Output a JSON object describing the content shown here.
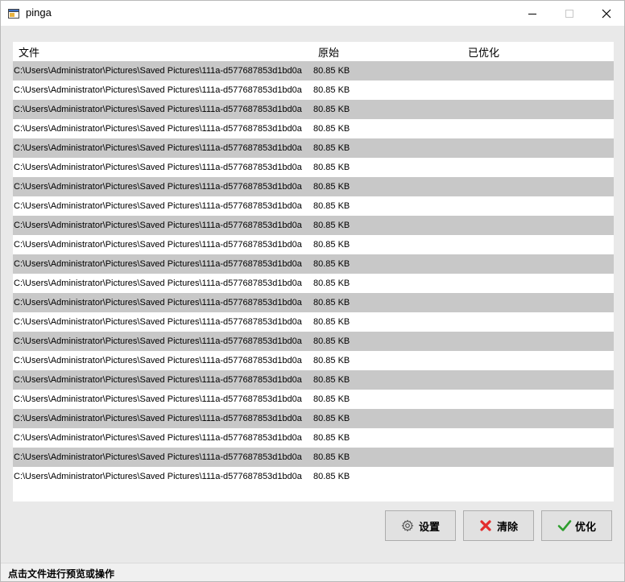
{
  "window": {
    "title": "pinga"
  },
  "table": {
    "columns": {
      "file": "文件",
      "original": "原始",
      "optimized": "已优化"
    },
    "rows": [
      {
        "path": "C:\\Users\\Administrator\\Pictures\\Saved Pictures\\111a-d577687853d1bd0a",
        "size": "80.85 KB",
        "optimized": ""
      },
      {
        "path": "C:\\Users\\Administrator\\Pictures\\Saved Pictures\\111a-d577687853d1bd0a",
        "size": "80.85 KB",
        "optimized": ""
      },
      {
        "path": "C:\\Users\\Administrator\\Pictures\\Saved Pictures\\111a-d577687853d1bd0a",
        "size": "80.85 KB",
        "optimized": ""
      },
      {
        "path": "C:\\Users\\Administrator\\Pictures\\Saved Pictures\\111a-d577687853d1bd0a",
        "size": "80.85 KB",
        "optimized": ""
      },
      {
        "path": "C:\\Users\\Administrator\\Pictures\\Saved Pictures\\111a-d577687853d1bd0a",
        "size": "80.85 KB",
        "optimized": ""
      },
      {
        "path": "C:\\Users\\Administrator\\Pictures\\Saved Pictures\\111a-d577687853d1bd0a",
        "size": "80.85 KB",
        "optimized": ""
      },
      {
        "path": "C:\\Users\\Administrator\\Pictures\\Saved Pictures\\111a-d577687853d1bd0a",
        "size": "80.85 KB",
        "optimized": ""
      },
      {
        "path": "C:\\Users\\Administrator\\Pictures\\Saved Pictures\\111a-d577687853d1bd0a",
        "size": "80.85 KB",
        "optimized": ""
      },
      {
        "path": "C:\\Users\\Administrator\\Pictures\\Saved Pictures\\111a-d577687853d1bd0a",
        "size": "80.85 KB",
        "optimized": ""
      },
      {
        "path": "C:\\Users\\Administrator\\Pictures\\Saved Pictures\\111a-d577687853d1bd0a",
        "size": "80.85 KB",
        "optimized": ""
      },
      {
        "path": "C:\\Users\\Administrator\\Pictures\\Saved Pictures\\111a-d577687853d1bd0a",
        "size": "80.85 KB",
        "optimized": ""
      },
      {
        "path": "C:\\Users\\Administrator\\Pictures\\Saved Pictures\\111a-d577687853d1bd0a",
        "size": "80.85 KB",
        "optimized": ""
      },
      {
        "path": "C:\\Users\\Administrator\\Pictures\\Saved Pictures\\111a-d577687853d1bd0a",
        "size": "80.85 KB",
        "optimized": ""
      },
      {
        "path": "C:\\Users\\Administrator\\Pictures\\Saved Pictures\\111a-d577687853d1bd0a",
        "size": "80.85 KB",
        "optimized": ""
      },
      {
        "path": "C:\\Users\\Administrator\\Pictures\\Saved Pictures\\111a-d577687853d1bd0a",
        "size": "80.85 KB",
        "optimized": ""
      },
      {
        "path": "C:\\Users\\Administrator\\Pictures\\Saved Pictures\\111a-d577687853d1bd0a",
        "size": "80.85 KB",
        "optimized": ""
      },
      {
        "path": "C:\\Users\\Administrator\\Pictures\\Saved Pictures\\111a-d577687853d1bd0a",
        "size": "80.85 KB",
        "optimized": ""
      },
      {
        "path": "C:\\Users\\Administrator\\Pictures\\Saved Pictures\\111a-d577687853d1bd0a",
        "size": "80.85 KB",
        "optimized": ""
      },
      {
        "path": "C:\\Users\\Administrator\\Pictures\\Saved Pictures\\111a-d577687853d1bd0a",
        "size": "80.85 KB",
        "optimized": ""
      },
      {
        "path": "C:\\Users\\Administrator\\Pictures\\Saved Pictures\\111a-d577687853d1bd0a",
        "size": "80.85 KB",
        "optimized": ""
      },
      {
        "path": "C:\\Users\\Administrator\\Pictures\\Saved Pictures\\111a-d577687853d1bd0a",
        "size": "80.85 KB",
        "optimized": ""
      },
      {
        "path": "C:\\Users\\Administrator\\Pictures\\Saved Pictures\\111a-d577687853d1bd0a",
        "size": "80.85 KB",
        "optimized": ""
      }
    ]
  },
  "buttons": {
    "settings": {
      "label": "设置",
      "icon": "gear-icon"
    },
    "clear": {
      "label": "清除",
      "icon": "red-x-icon",
      "icon_color": "#e32d2d"
    },
    "optimize": {
      "label": "优化",
      "icon": "green-check-icon",
      "icon_color": "#2e9e2e"
    }
  },
  "status": {
    "text": "点击文件进行预览或操作"
  },
  "colors": {
    "row_alt": "#c8c8c8",
    "client_bg": "#e9e9e9"
  }
}
